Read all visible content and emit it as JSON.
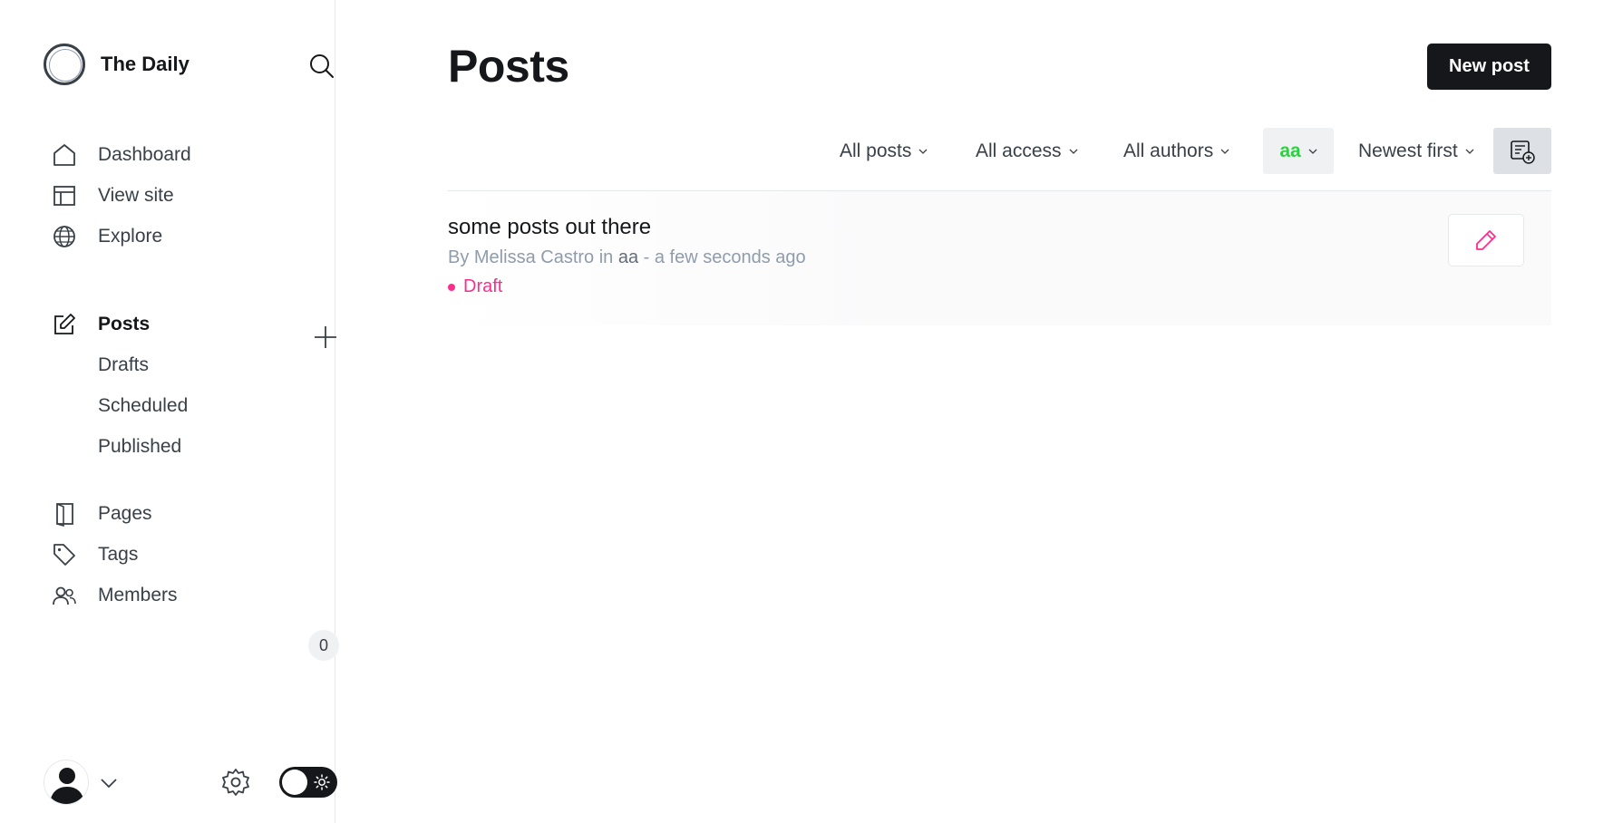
{
  "sidebar": {
    "brand": {
      "title": "The Daily",
      "logo_icon": "site-logo-icon"
    },
    "search_icon": "search-icon",
    "nav": [
      {
        "label": "Dashboard",
        "icon": "home-icon"
      },
      {
        "label": "View site",
        "icon": "layout-icon"
      },
      {
        "label": "Explore",
        "icon": "globe-icon"
      }
    ],
    "posts": {
      "label": "Posts",
      "icon": "edit-icon",
      "add_icon": "plus-icon",
      "sub_items": [
        {
          "label": "Drafts"
        },
        {
          "label": "Scheduled"
        },
        {
          "label": "Published"
        }
      ]
    },
    "secondary_nav": [
      {
        "label": "Pages",
        "icon": "page-icon"
      },
      {
        "label": "Tags",
        "icon": "tag-icon"
      },
      {
        "label": "Members",
        "icon": "members-icon",
        "count": "0"
      }
    ],
    "footer": {
      "avatar_icon": "user-avatar-icon",
      "caret_icon": "chevron-down-icon",
      "settings_icon": "gear-icon",
      "theme_toggle_icon": "sun-icon"
    }
  },
  "main": {
    "title": "Posts",
    "new_post_label": "New post",
    "filters": [
      {
        "label": "All posts",
        "selected": false
      },
      {
        "label": "All access",
        "selected": false
      },
      {
        "label": "All authors",
        "selected": false
      },
      {
        "label": "aa",
        "selected": true
      },
      {
        "label": "Newest first",
        "selected": false
      }
    ],
    "view_toggle_icon": "card-view-icon",
    "posts": [
      {
        "title": "some posts out there",
        "meta_prefix": "By Melissa Castro in ",
        "tag": "aa",
        "meta_suffix": " - a few seconds ago",
        "status": "Draft",
        "edit_icon": "pencil-icon"
      }
    ]
  },
  "colors": {
    "primary_dark": "#15171a",
    "draft_pink": "#fb2d8d",
    "tag_green": "#30cf43",
    "muted": "#8e9cac"
  }
}
